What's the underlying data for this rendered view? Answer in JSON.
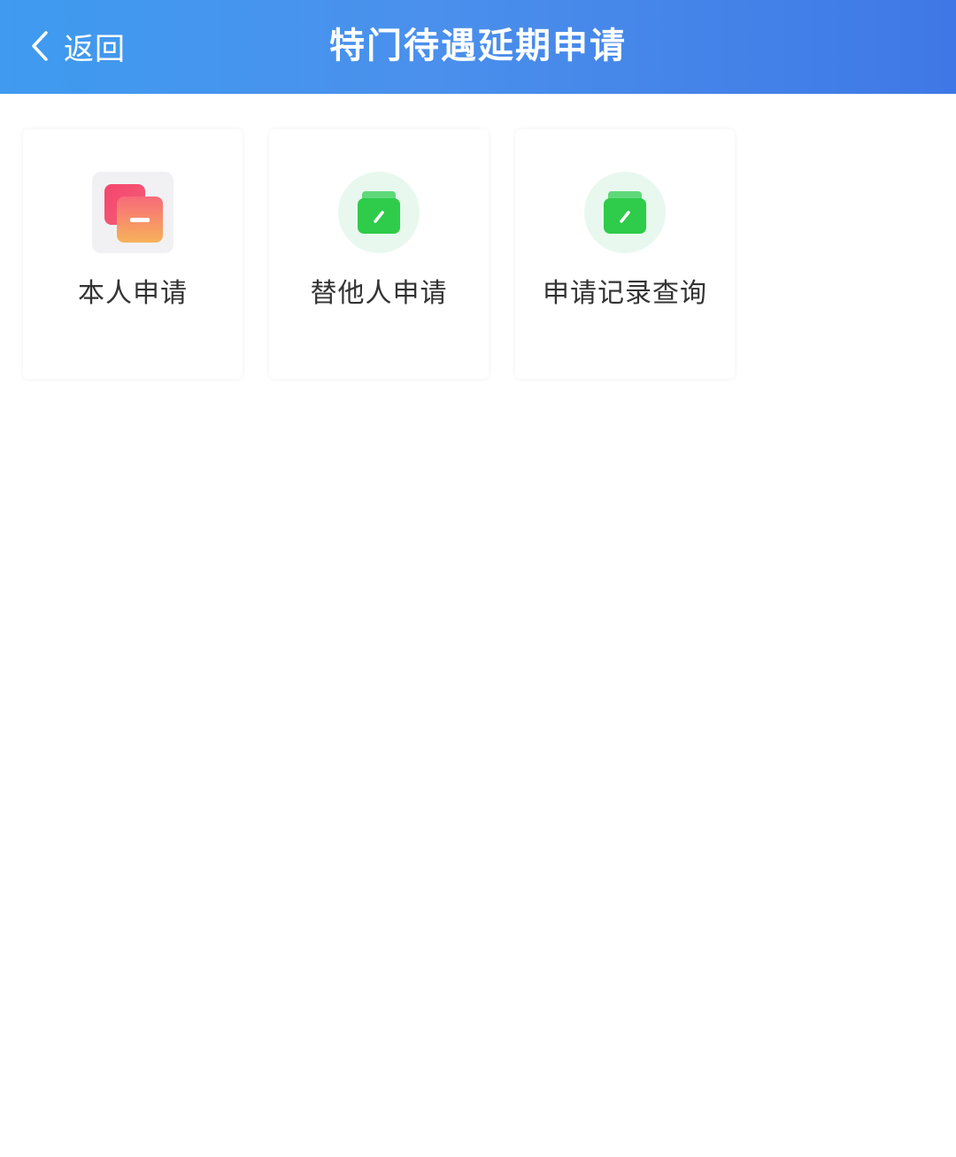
{
  "header": {
    "back_label": "返回",
    "title": "特门待遇延期申请",
    "gradient_start": "#3f9bef",
    "gradient_end": "#3f78e6"
  },
  "menu": {
    "items": [
      {
        "label": "本人申请",
        "icon": "self-apply-icon"
      },
      {
        "label": "替他人申请",
        "icon": "folder-edit-icon"
      },
      {
        "label": "申请记录查询",
        "icon": "folder-edit-icon"
      }
    ]
  },
  "colors": {
    "label_text": "#333333",
    "green_icon": "#2ecc4a",
    "red_icon": "#f0456f",
    "orange_icon": "#f7a95a"
  }
}
